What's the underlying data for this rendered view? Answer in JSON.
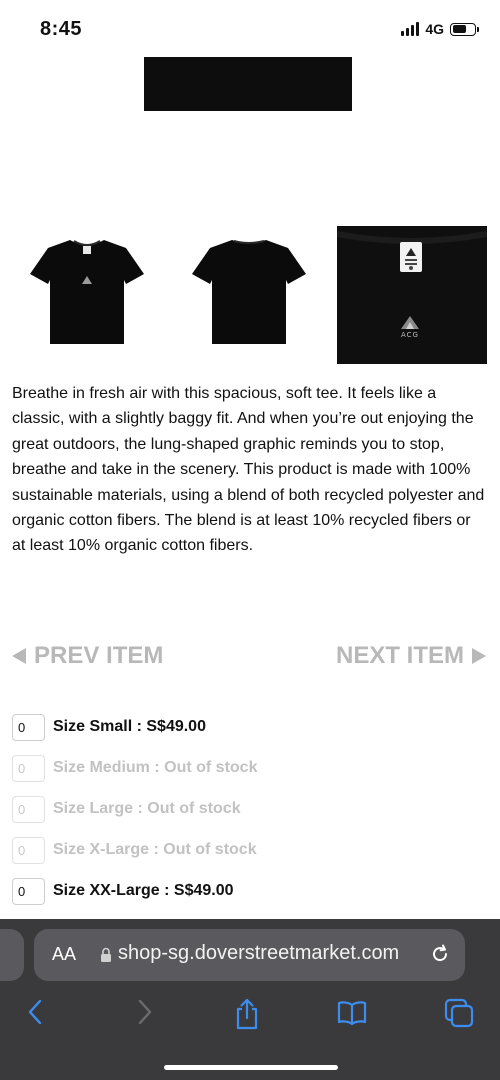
{
  "status": {
    "time": "8:45",
    "network": "4G"
  },
  "product": {
    "description": "Breathe in  fresh air with this spacious, soft tee. It feels like a classic, with a slightly baggy fit. And when you’re out enjoying the great outdoors, the lung-shaped graphic reminds you to stop, breathe and take in the scenery. This product is made with 100% sustainable materials, using a blend of both recycled polyester and organic cotton fibers. The blend is at least 10% recycled fibers or at least 10% organic cotton fibers.",
    "thumbnail_logo_text": "ACG"
  },
  "pager": {
    "prev_label": "PREV ITEM",
    "next_label": "NEXT ITEM"
  },
  "sizes": [
    {
      "qty": "0",
      "label": "Size Small : S$49.00",
      "in_stock": true
    },
    {
      "qty": "0",
      "label": "Size Medium : Out of stock",
      "in_stock": false
    },
    {
      "qty": "0",
      "label": "Size Large : Out of stock",
      "in_stock": false
    },
    {
      "qty": "0",
      "label": "Size X-Large : Out of stock",
      "in_stock": false
    },
    {
      "qty": "0",
      "label": "Size XX-Large : S$49.00",
      "in_stock": true
    }
  ],
  "browser": {
    "text_size_label": "AA",
    "url": "shop-sg.doverstreetmarket.com"
  },
  "colors": {
    "toolbar_bg": "#3a3a3c",
    "url_pill_bg": "#5a5a5e",
    "accent": "#3d8cf0",
    "disabled_text": "#c2c2c2"
  },
  "icons": [
    "signal-icon",
    "battery-icon",
    "lock-icon",
    "reload-icon",
    "back-icon",
    "forward-icon",
    "share-icon",
    "bookmarks-icon",
    "tabs-icon"
  ]
}
